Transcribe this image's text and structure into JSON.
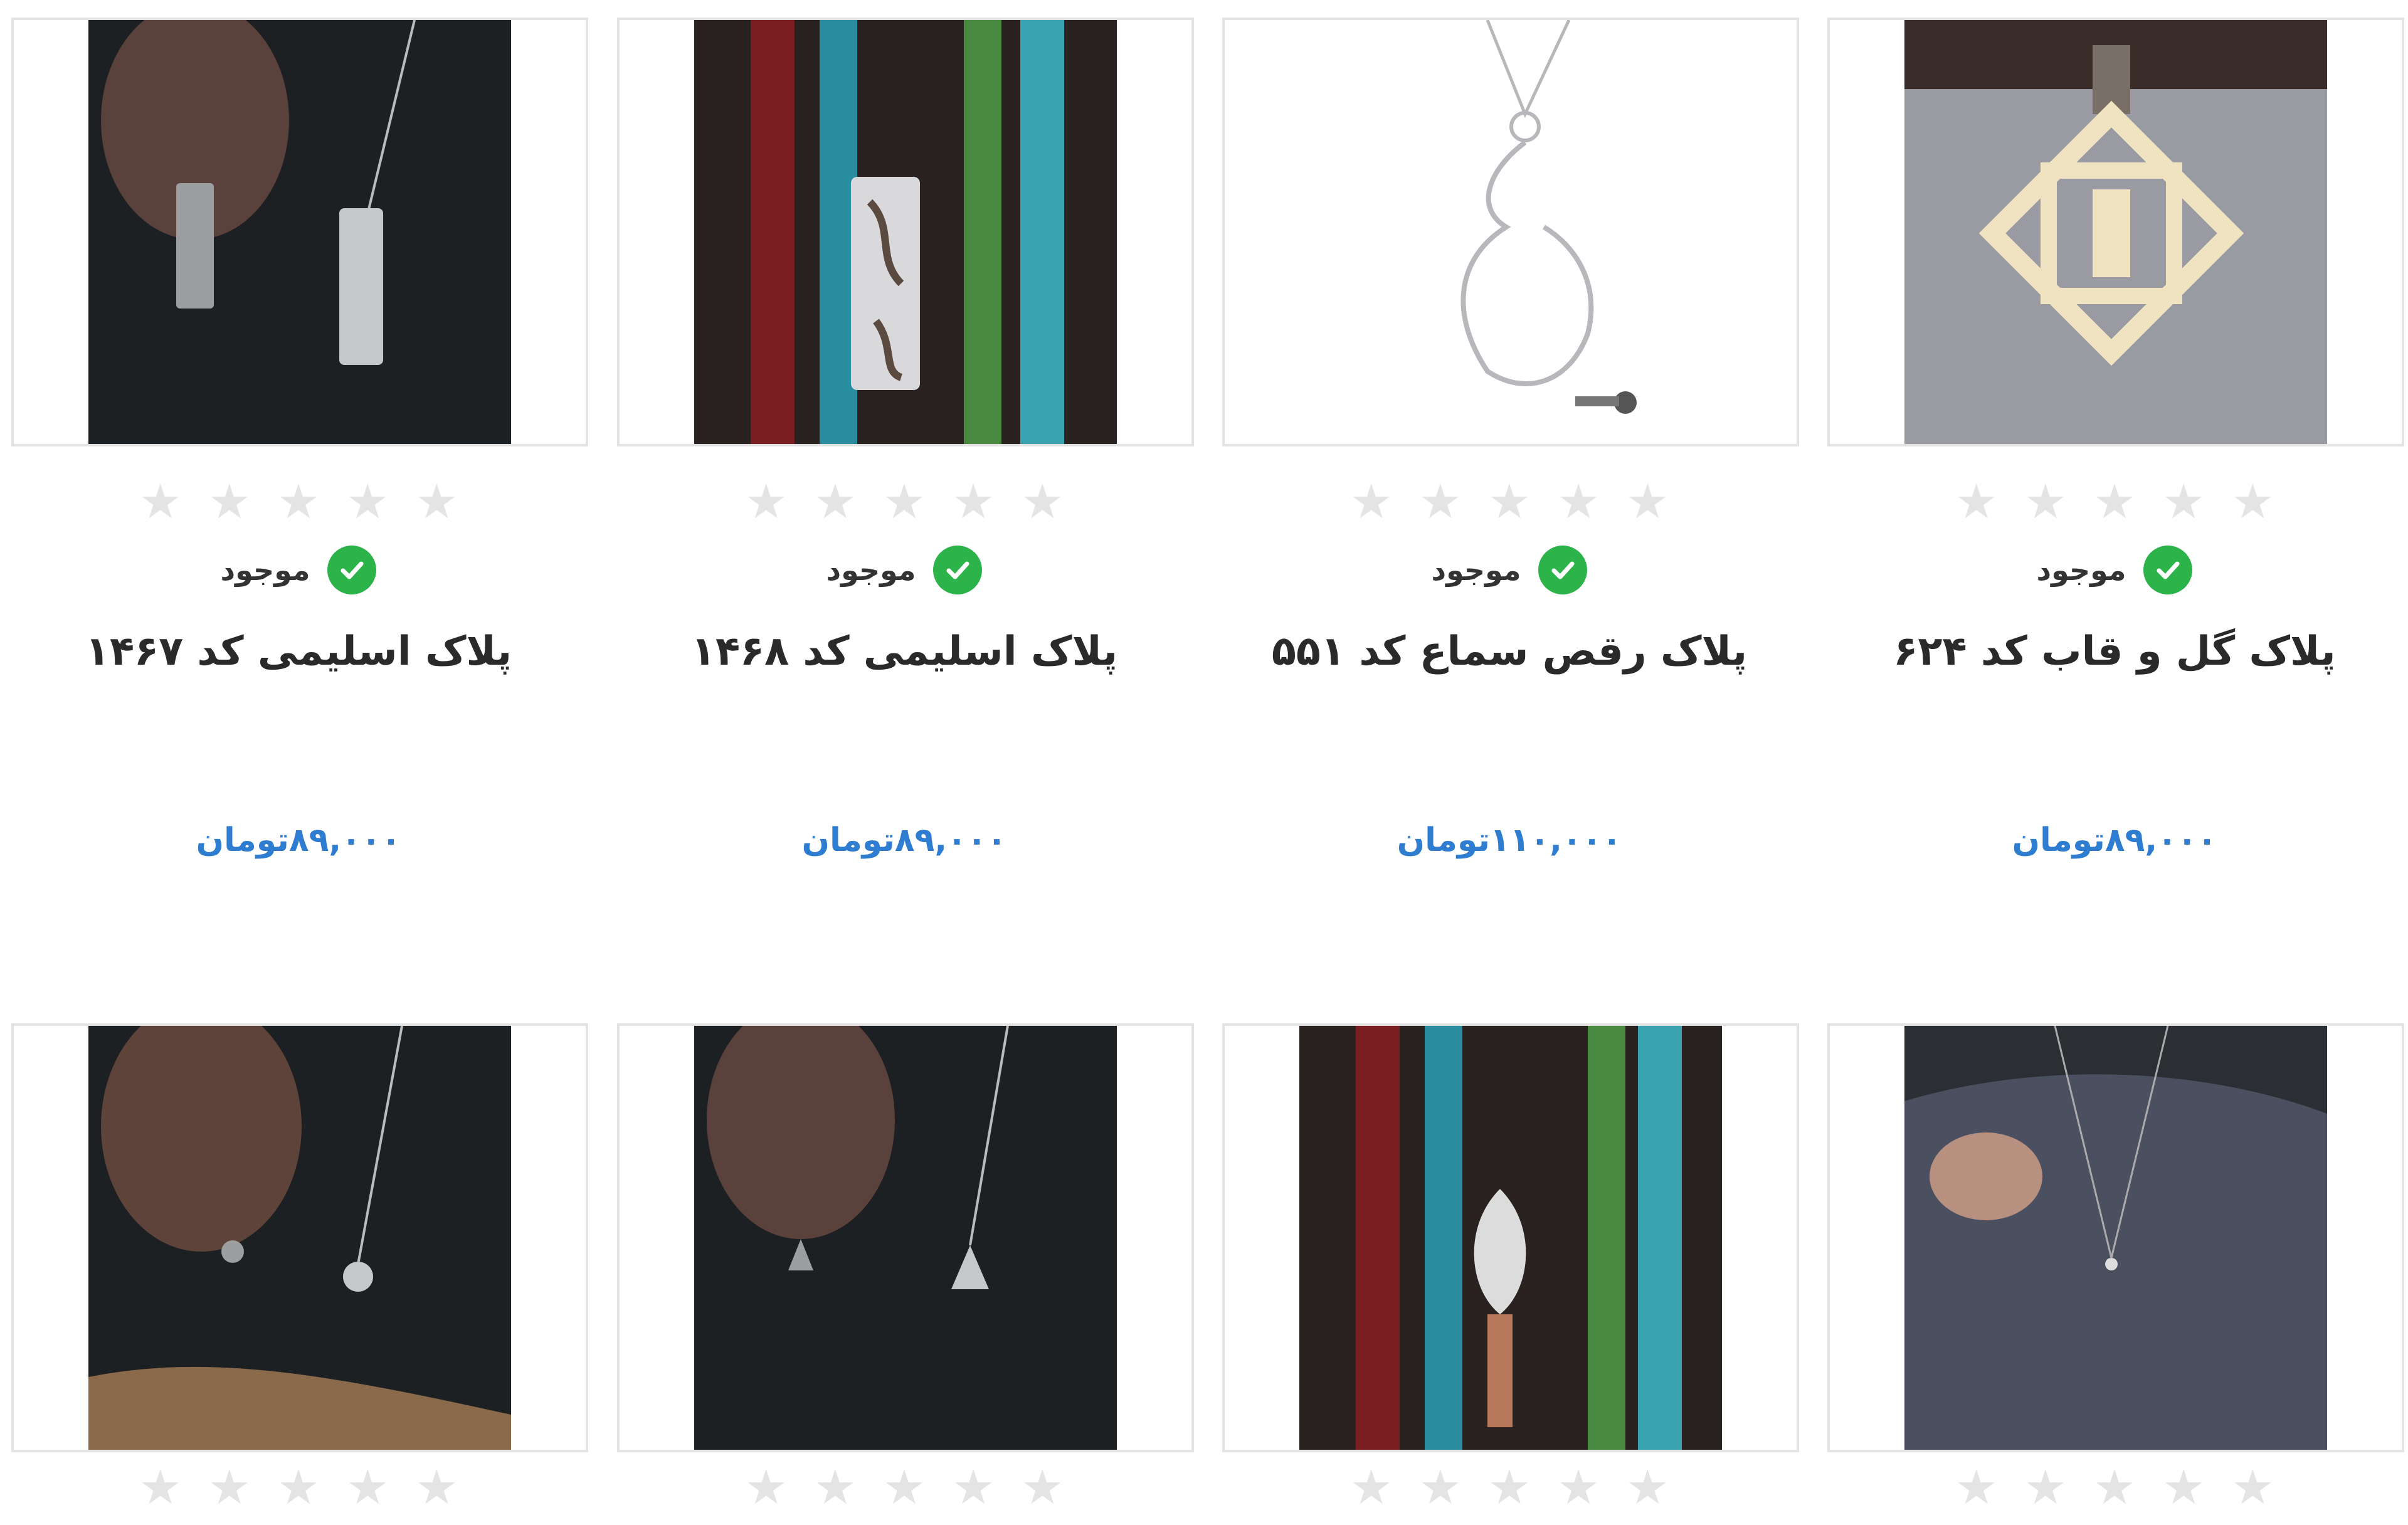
{
  "stock_label": "موجود",
  "rating_stars": 5,
  "products": [
    {
      "title": "پلاک گل و قاب کد ۶۲۴",
      "price": "۸۹,۰۰۰تومان",
      "rating": 0,
      "image_icon": "pendant-diamond-icon"
    },
    {
      "title": "پلاک رقص سماع کد ۵۵۱",
      "price": "۱۱۰,۰۰۰تومان",
      "rating": 0,
      "image_icon": "pendant-dervish-icon"
    },
    {
      "title": "پلاک اسلیمی کد ۱۴۶۸",
      "price": "۸۹,۰۰۰تومان",
      "rating": 0,
      "image_icon": "pendant-bar-icon"
    },
    {
      "title": "پلاک اسلیمی کد ۱۴۶۷",
      "price": "۸۹,۰۰۰تومان",
      "rating": 0,
      "image_icon": "pendant-bar-icon"
    }
  ],
  "second_row": [
    {
      "image_icon": "pendant-scarf-icon"
    },
    {
      "image_icon": "pendant-ornament-icon"
    },
    {
      "image_icon": "pendant-drop-icon"
    },
    {
      "image_icon": "pendant-round-icon"
    }
  ],
  "colors": {
    "price": "#2f7dd0",
    "in_stock": "#2cb34a",
    "star_empty": "#e4e4e4",
    "card_border": "#e3e3e3"
  }
}
